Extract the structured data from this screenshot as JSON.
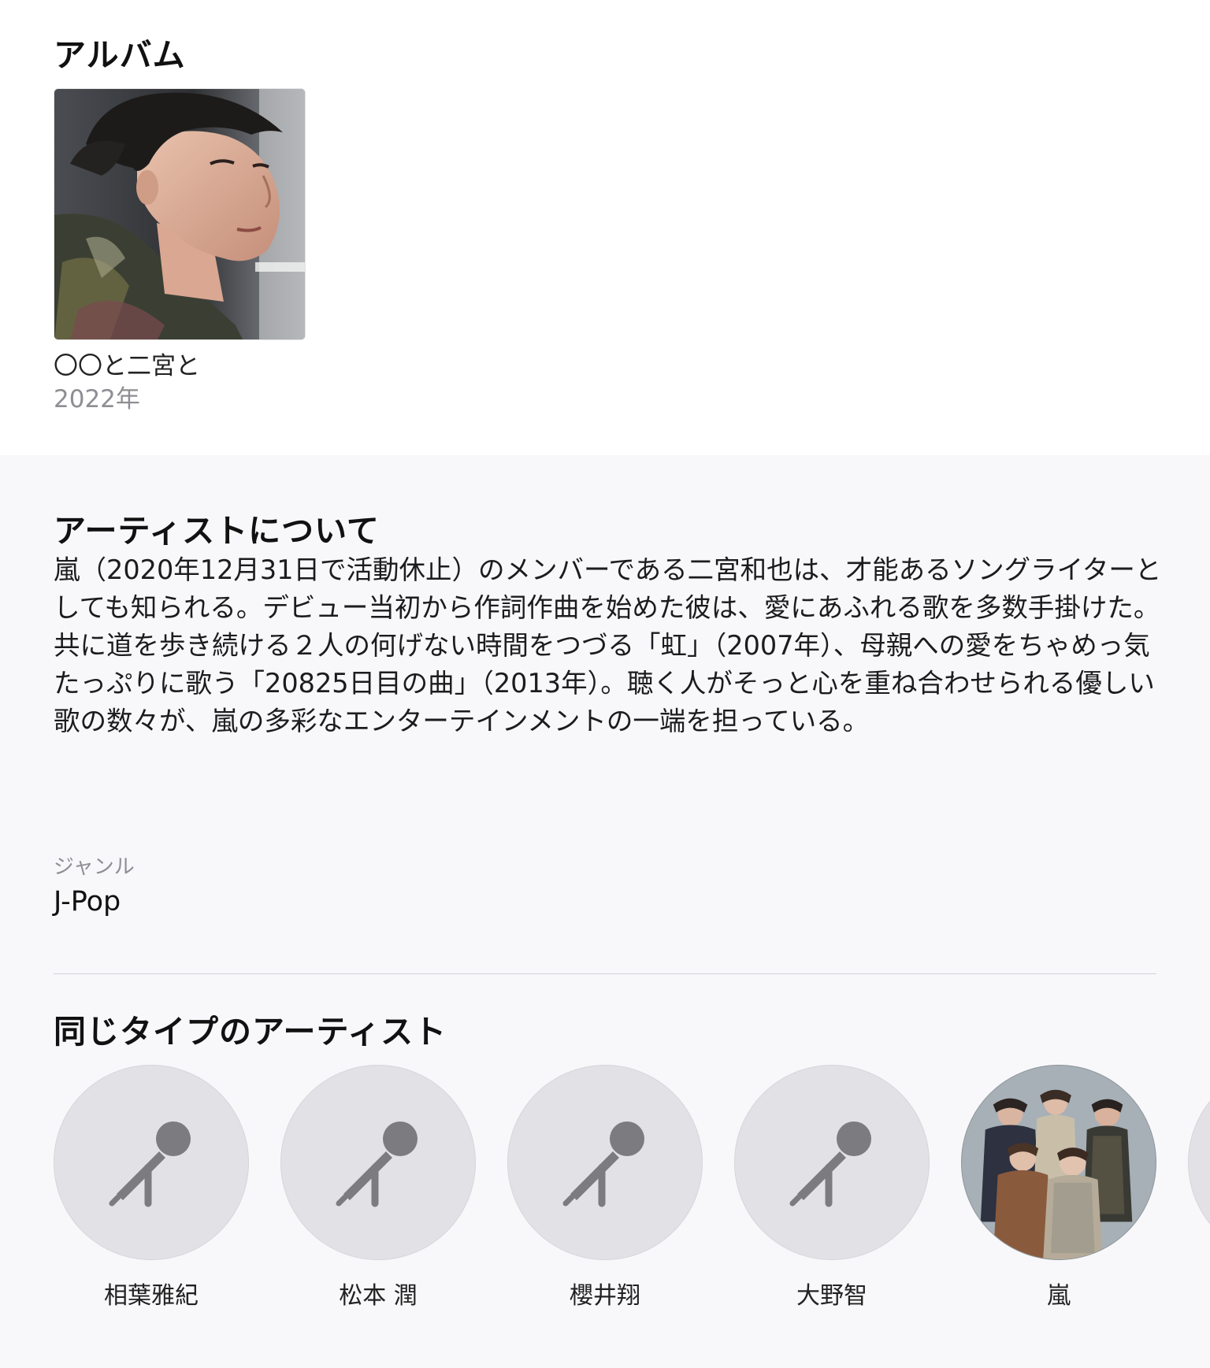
{
  "albums_section": {
    "title": "アルバム",
    "items": [
      {
        "title": "〇〇と二宮と",
        "year": "2022年"
      }
    ]
  },
  "about_section": {
    "title": "アーティストについて",
    "body": "嵐（2020年12月31日で活動休止）のメンバーである二宮和也は、才能あるソングライターとしても知られる。デビュー当初から作詞作曲を始めた彼は、愛にあふれる歌を多数手掛けた。共に道を歩き続ける２人の何げない時間をつづる「虹」（2007年）、母親への愛をちゃめっ気たっぷりに歌う「20825日目の曲」（2013年）。聴く人がそっと心を重ね合わせられる優しい歌の数々が、嵐の多彩なエンターテインメントの一端を担っている。",
    "genre_label": "ジャンル",
    "genre_value": "J-Pop"
  },
  "similar_section": {
    "title": "同じタイプのアーティスト",
    "artists": [
      {
        "name": "相葉雅紀",
        "icon": "microphone-icon"
      },
      {
        "name": "松本 潤",
        "icon": "microphone-icon"
      },
      {
        "name": "櫻井翔",
        "icon": "microphone-icon"
      },
      {
        "name": "大野智",
        "icon": "microphone-icon"
      },
      {
        "name": "嵐",
        "icon": "group-photo"
      }
    ]
  },
  "colors": {
    "page_background": "#f8f8fb",
    "album_background": "#ffffff",
    "secondary_text": "#8e8e93",
    "placeholder_circle": "#e2e2e6",
    "placeholder_icon": "#7c7c80"
  }
}
